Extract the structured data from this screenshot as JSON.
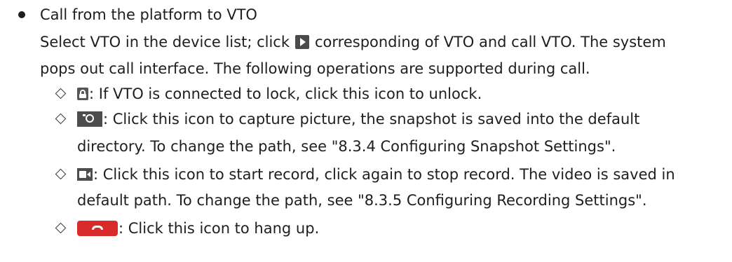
{
  "section": {
    "heading": "Call from the platform to VTO",
    "intro": {
      "part1": "Select VTO in the device list; click",
      "part2": "corresponding of VTO and call VTO. The system",
      "line2": "pops out call interface. The following operations are supported during call."
    },
    "items": [
      {
        "icon": "unlock-icon",
        "line1": ": If VTO is connected to lock, click this icon to unlock."
      },
      {
        "icon": "snapshot-camera-icon",
        "line1": ": Click this icon to capture picture, the snapshot is saved into the default",
        "line2": "directory. To change the path, see \"8.3.4 Configuring Snapshot Settings\"."
      },
      {
        "icon": "record-video-icon",
        "line1": ": Click this icon to start record, click again to stop record. The video is saved in",
        "line2": "default path. To change the path, see \"8.3.5 Configuring Recording Settings\"."
      },
      {
        "icon": "hang-up-icon",
        "line1": ": Click this icon to hang up."
      }
    ]
  },
  "colors": {
    "text": "#1e1e1e",
    "icon_dark": "#4d4d4d",
    "hangup_red": "#d92b2b"
  }
}
